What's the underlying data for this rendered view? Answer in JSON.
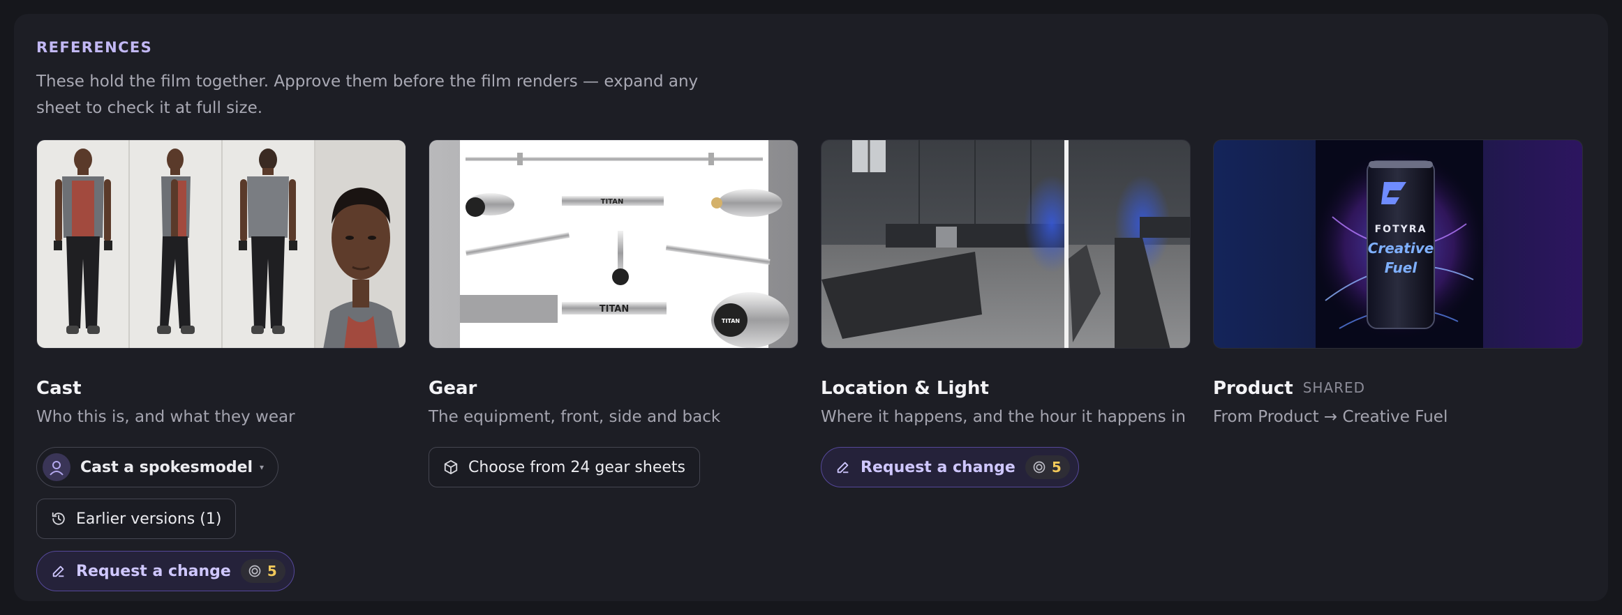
{
  "references": {
    "label": "REFERENCES",
    "description": "These hold the film together. Approve them before the film renders — expand any sheet to check it at full size."
  },
  "cards": {
    "cast": {
      "title": "Cast",
      "subtitle": "Who this is, and what they wear",
      "primary_button": "Cast a spokesmodel",
      "versions_button": "Earlier versions (1)",
      "change_button": "Request a change",
      "credit_cost": "5"
    },
    "gear": {
      "title": "Gear",
      "subtitle": "The equipment, front, side and back",
      "choose_button": "Choose from 24 gear sheets",
      "brand_text": "TITAN"
    },
    "location": {
      "title": "Location & Light",
      "subtitle": "Where it happens, and the hour it happens in",
      "change_button": "Request a change",
      "credit_cost": "5"
    },
    "product": {
      "title": "Product",
      "badge": "SHARED",
      "subtitle": "From Product → Creative Fuel",
      "can_brand": "FOTYRA",
      "can_line1": "Creative",
      "can_line2": "Fuel"
    }
  },
  "icons": {
    "avatar": "user-icon",
    "history": "history-icon",
    "edit": "pencil-icon",
    "box": "box-icon",
    "coin": "coin-icon"
  },
  "colors": {
    "accent": "#c2b8f4",
    "credit": "#f2c95a",
    "background": "#1d1e25"
  }
}
